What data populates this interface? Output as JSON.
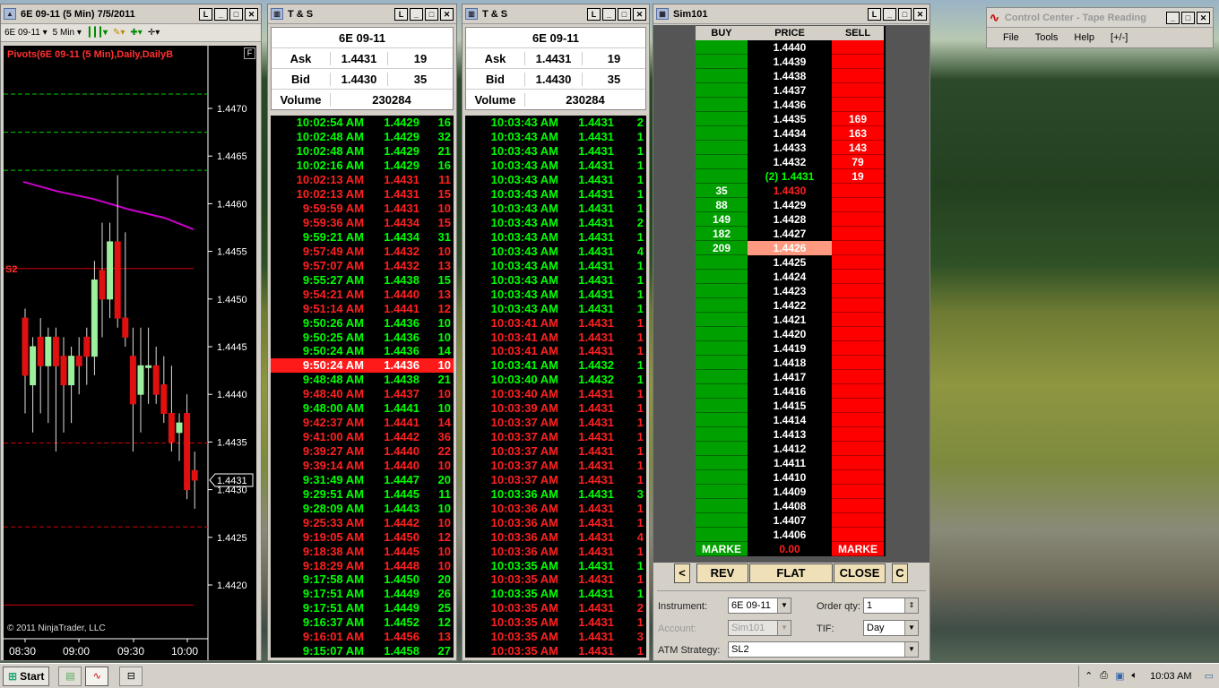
{
  "chart": {
    "title": "6E 09-11 (5 Min)  7/5/2011",
    "instrument": "6E 09-11",
    "interval": "5 Min",
    "indicator": "Pivots(6E 09-11 (5 Min),Daily,DailyB",
    "s2": "S2",
    "copyright": "© 2011 NinjaTrader, LLC",
    "yticks": [
      "1.4470",
      "1.4465",
      "1.4460",
      "1.4455",
      "1.4450",
      "1.4445",
      "1.4440",
      "1.4435",
      "1.4431",
      "1.4430",
      "1.4425",
      "1.4420"
    ],
    "xticks": [
      "08:30",
      "09:00",
      "09:30",
      "10:00"
    ],
    "f_button": "F"
  },
  "ts1": {
    "title": "T & S",
    "symbol": "6E 09-11",
    "ask_label": "Ask",
    "ask": "1.4431",
    "ask_size": "19",
    "bid_label": "Bid",
    "bid": "1.4430",
    "bid_size": "35",
    "volume_label": "Volume",
    "volume": "230284",
    "rows": [
      [
        "10:02:54 AM",
        "1.4429",
        "16",
        "g"
      ],
      [
        "10:02:48 AM",
        "1.4429",
        "32",
        "g"
      ],
      [
        "10:02:48 AM",
        "1.4429",
        "21",
        "g"
      ],
      [
        "10:02:16 AM",
        "1.4429",
        "16",
        "g"
      ],
      [
        "10:02:13 AM",
        "1.4431",
        "11",
        "r"
      ],
      [
        "10:02:13 AM",
        "1.4431",
        "15",
        "r"
      ],
      [
        "9:59:59 AM",
        "1.4431",
        "10",
        "r"
      ],
      [
        "9:59:36 AM",
        "1.4434",
        "15",
        "r"
      ],
      [
        "9:59:21 AM",
        "1.4434",
        "31",
        "g"
      ],
      [
        "9:57:49 AM",
        "1.4432",
        "10",
        "r"
      ],
      [
        "9:57:07 AM",
        "1.4432",
        "13",
        "r"
      ],
      [
        "9:55:27 AM",
        "1.4438",
        "15",
        "g"
      ],
      [
        "9:54:21 AM",
        "1.4440",
        "13",
        "r"
      ],
      [
        "9:51:14 AM",
        "1.4441",
        "12",
        "r"
      ],
      [
        "9:50:26 AM",
        "1.4436",
        "10",
        "g"
      ],
      [
        "9:50:25 AM",
        "1.4436",
        "10",
        "g"
      ],
      [
        "9:50:24 AM",
        "1.4436",
        "14",
        "g"
      ],
      [
        "9:50:24 AM",
        "1.4436",
        "10",
        "hl"
      ],
      [
        "9:48:48 AM",
        "1.4438",
        "21",
        "g"
      ],
      [
        "9:48:40 AM",
        "1.4437",
        "10",
        "r"
      ],
      [
        "9:48:00 AM",
        "1.4441",
        "10",
        "g"
      ],
      [
        "9:42:37 AM",
        "1.4441",
        "14",
        "r"
      ],
      [
        "9:41:00 AM",
        "1.4442",
        "36",
        "r"
      ],
      [
        "9:39:27 AM",
        "1.4440",
        "22",
        "r"
      ],
      [
        "9:39:14 AM",
        "1.4440",
        "10",
        "r"
      ],
      [
        "9:31:49 AM",
        "1.4447",
        "20",
        "g"
      ],
      [
        "9:29:51 AM",
        "1.4445",
        "11",
        "g"
      ],
      [
        "9:28:09 AM",
        "1.4443",
        "10",
        "g"
      ],
      [
        "9:25:33 AM",
        "1.4442",
        "10",
        "r"
      ],
      [
        "9:19:05 AM",
        "1.4450",
        "12",
        "r"
      ],
      [
        "9:18:38 AM",
        "1.4445",
        "10",
        "r"
      ],
      [
        "9:18:29 AM",
        "1.4448",
        "10",
        "r"
      ],
      [
        "9:17:58 AM",
        "1.4450",
        "20",
        "g"
      ],
      [
        "9:17:51 AM",
        "1.4449",
        "26",
        "g"
      ],
      [
        "9:17:51 AM",
        "1.4449",
        "25",
        "g"
      ],
      [
        "9:16:37 AM",
        "1.4452",
        "12",
        "g"
      ],
      [
        "9:16:01 AM",
        "1.4456",
        "13",
        "r"
      ],
      [
        "9:15:07 AM",
        "1.4458",
        "27",
        "g"
      ]
    ]
  },
  "ts2": {
    "title": "T & S",
    "symbol": "6E 09-11",
    "ask_label": "Ask",
    "ask": "1.4431",
    "ask_size": "19",
    "bid_label": "Bid",
    "bid": "1.4430",
    "bid_size": "35",
    "volume_label": "Volume",
    "volume": "230284",
    "rows": [
      [
        "10:03:43 AM",
        "1.4431",
        "2",
        "g"
      ],
      [
        "10:03:43 AM",
        "1.4431",
        "1",
        "g"
      ],
      [
        "10:03:43 AM",
        "1.4431",
        "1",
        "g"
      ],
      [
        "10:03:43 AM",
        "1.4431",
        "1",
        "g"
      ],
      [
        "10:03:43 AM",
        "1.4431",
        "1",
        "g"
      ],
      [
        "10:03:43 AM",
        "1.4431",
        "1",
        "g"
      ],
      [
        "10:03:43 AM",
        "1.4431",
        "1",
        "g"
      ],
      [
        "10:03:43 AM",
        "1.4431",
        "2",
        "g"
      ],
      [
        "10:03:43 AM",
        "1.4431",
        "1",
        "g"
      ],
      [
        "10:03:43 AM",
        "1.4431",
        "4",
        "g"
      ],
      [
        "10:03:43 AM",
        "1.4431",
        "1",
        "g"
      ],
      [
        "10:03:43 AM",
        "1.4431",
        "1",
        "g"
      ],
      [
        "10:03:43 AM",
        "1.4431",
        "1",
        "g"
      ],
      [
        "10:03:43 AM",
        "1.4431",
        "1",
        "g"
      ],
      [
        "10:03:41 AM",
        "1.4431",
        "1",
        "r"
      ],
      [
        "10:03:41 AM",
        "1.4431",
        "1",
        "r"
      ],
      [
        "10:03:41 AM",
        "1.4431",
        "1",
        "r"
      ],
      [
        "10:03:41 AM",
        "1.4432",
        "1",
        "g"
      ],
      [
        "10:03:40 AM",
        "1.4432",
        "1",
        "g"
      ],
      [
        "10:03:40 AM",
        "1.4431",
        "1",
        "r"
      ],
      [
        "10:03:39 AM",
        "1.4431",
        "1",
        "r"
      ],
      [
        "10:03:37 AM",
        "1.4431",
        "1",
        "r"
      ],
      [
        "10:03:37 AM",
        "1.4431",
        "1",
        "r"
      ],
      [
        "10:03:37 AM",
        "1.4431",
        "1",
        "r"
      ],
      [
        "10:03:37 AM",
        "1.4431",
        "1",
        "r"
      ],
      [
        "10:03:37 AM",
        "1.4431",
        "1",
        "r"
      ],
      [
        "10:03:36 AM",
        "1.4431",
        "3",
        "g"
      ],
      [
        "10:03:36 AM",
        "1.4431",
        "1",
        "r"
      ],
      [
        "10:03:36 AM",
        "1.4431",
        "1",
        "r"
      ],
      [
        "10:03:36 AM",
        "1.4431",
        "4",
        "r"
      ],
      [
        "10:03:36 AM",
        "1.4431",
        "1",
        "r"
      ],
      [
        "10:03:35 AM",
        "1.4431",
        "1",
        "g"
      ],
      [
        "10:03:35 AM",
        "1.4431",
        "1",
        "r"
      ],
      [
        "10:03:35 AM",
        "1.4431",
        "1",
        "g"
      ],
      [
        "10:03:35 AM",
        "1.4431",
        "2",
        "r"
      ],
      [
        "10:03:35 AM",
        "1.4431",
        "1",
        "r"
      ],
      [
        "10:03:35 AM",
        "1.4431",
        "3",
        "r"
      ],
      [
        "10:03:35 AM",
        "1.4431",
        "1",
        "r"
      ]
    ]
  },
  "dom": {
    "title": "Sim101",
    "col_buy": "BUY",
    "col_price": "PRICE",
    "col_sell": "SELL",
    "rows": [
      [
        "",
        "1.4440",
        ""
      ],
      [
        "",
        "1.4439",
        ""
      ],
      [
        "",
        "1.4438",
        ""
      ],
      [
        "",
        "1.4437",
        ""
      ],
      [
        "",
        "1.4436",
        ""
      ],
      [
        "",
        "1.4435",
        "169"
      ],
      [
        "",
        "1.4434",
        "163"
      ],
      [
        "",
        "1.4433",
        "143"
      ],
      [
        "",
        "1.4432",
        "79"
      ],
      [
        "",
        "(2) 1.4431",
        "19"
      ],
      [
        "35",
        "1.4430",
        ""
      ],
      [
        "88",
        "1.4429",
        ""
      ],
      [
        "149",
        "1.4428",
        ""
      ],
      [
        "182",
        "1.4427",
        ""
      ],
      [
        "209",
        "1.4426",
        ""
      ],
      [
        "",
        "1.4425",
        ""
      ],
      [
        "",
        "1.4424",
        ""
      ],
      [
        "",
        "1.4423",
        ""
      ],
      [
        "",
        "1.4422",
        ""
      ],
      [
        "",
        "1.4421",
        ""
      ],
      [
        "",
        "1.4420",
        ""
      ],
      [
        "",
        "1.4419",
        ""
      ],
      [
        "",
        "1.4418",
        ""
      ],
      [
        "",
        "1.4417",
        ""
      ],
      [
        "",
        "1.4416",
        ""
      ],
      [
        "",
        "1.4415",
        ""
      ],
      [
        "",
        "1.4414",
        ""
      ],
      [
        "",
        "1.4413",
        ""
      ],
      [
        "",
        "1.4412",
        ""
      ],
      [
        "",
        "1.4411",
        ""
      ],
      [
        "",
        "1.4410",
        ""
      ],
      [
        "",
        "1.4409",
        ""
      ],
      [
        "",
        "1.4408",
        ""
      ],
      [
        "",
        "1.4407",
        ""
      ],
      [
        "",
        "1.4406",
        ""
      ]
    ],
    "market_buy": "MARKE",
    "pnl": "0.00",
    "market_sell": "MARKE",
    "btn_left": "<",
    "btn_rev": "REV",
    "btn_flat": "FLAT",
    "btn_close": "CLOSE",
    "btn_c": "C",
    "instrument_label": "Instrument:",
    "instrument": "6E 09-11",
    "orderqty_label": "Order qty:",
    "orderqty": "1",
    "account_label": "Account:",
    "account": "Sim101",
    "tif_label": "TIF:",
    "tif": "Day",
    "atm_label": "ATM Strategy:",
    "atm": "SL2"
  },
  "control": {
    "title": "Control Center - Tape Reading",
    "menu": [
      "File",
      "Tools",
      "Help",
      "[+/-]"
    ]
  },
  "taskbar": {
    "start": "Start",
    "time": "10:03 AM"
  },
  "colors": {
    "buy": "#00a000",
    "sell": "#ff0000",
    "up_text": "#00ff00",
    "down_text": "#ff2020",
    "pivot_green": "#00cc00",
    "pivot_red": "#d00000",
    "ma": "#cc00cc"
  }
}
